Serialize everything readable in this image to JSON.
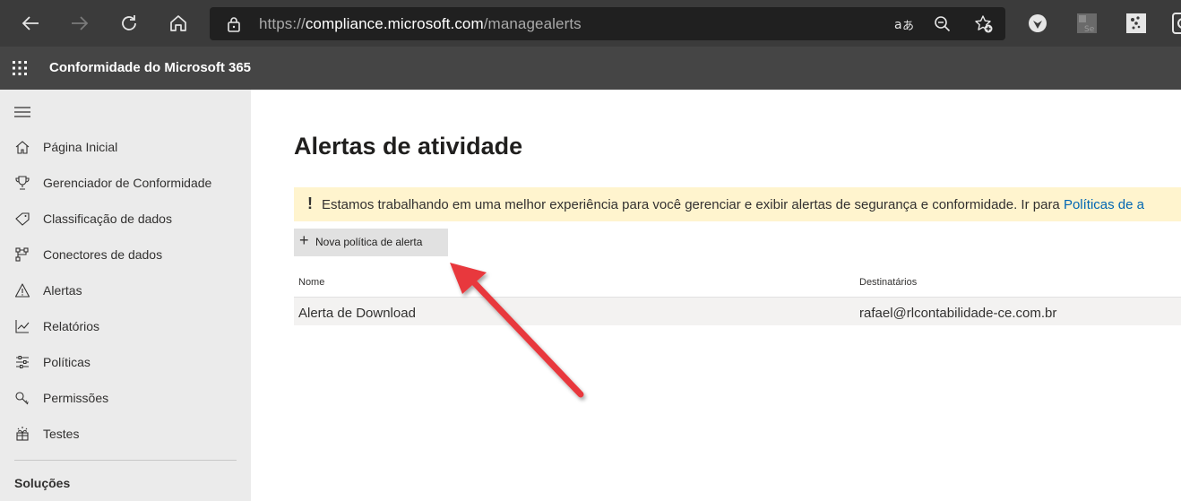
{
  "browser": {
    "url_prefix": "https://",
    "url_host": "compliance.microsoft.com",
    "url_path": "/managealerts"
  },
  "app": {
    "title": "Conformidade do Microsoft 365"
  },
  "nav": {
    "items": [
      {
        "label": "Página Inicial",
        "icon": "home-icon"
      },
      {
        "label": "Gerenciador de Conformidade",
        "icon": "trophy-icon"
      },
      {
        "label": "Classificação de dados",
        "icon": "tag-icon"
      },
      {
        "label": "Conectores de dados",
        "icon": "connector-icon"
      },
      {
        "label": "Alertas",
        "icon": "warning-icon"
      },
      {
        "label": "Relatórios",
        "icon": "chart-icon"
      },
      {
        "label": "Políticas",
        "icon": "sliders-icon"
      },
      {
        "label": "Permissões",
        "icon": "key-icon"
      },
      {
        "label": "Testes",
        "icon": "trials-icon"
      }
    ],
    "section_solutions": "Soluções"
  },
  "main": {
    "title": "Alertas de atividade",
    "banner": {
      "icon": "!",
      "message": "Estamos trabalhando em uma melhor experiência para você gerenciar e exibir alertas de segurança e conformidade. Ir para ",
      "link": "Políticas de a"
    },
    "new_button": {
      "icon": "+",
      "label": "Nova política de alerta"
    },
    "table": {
      "headers": [
        "Nome",
        "Destinatários"
      ],
      "rows": [
        {
          "name": "Alerta de Download",
          "recipients": "rafael@rlcontabilidade-ce.com.br"
        }
      ]
    }
  },
  "colors": {
    "chrome": "#3b3b3b",
    "appbar": "#454545",
    "nav_bg": "#ebebeb",
    "banner_bg": "#fff4ce",
    "link": "#0066b3",
    "annotation_arrow": "#e8393c"
  }
}
